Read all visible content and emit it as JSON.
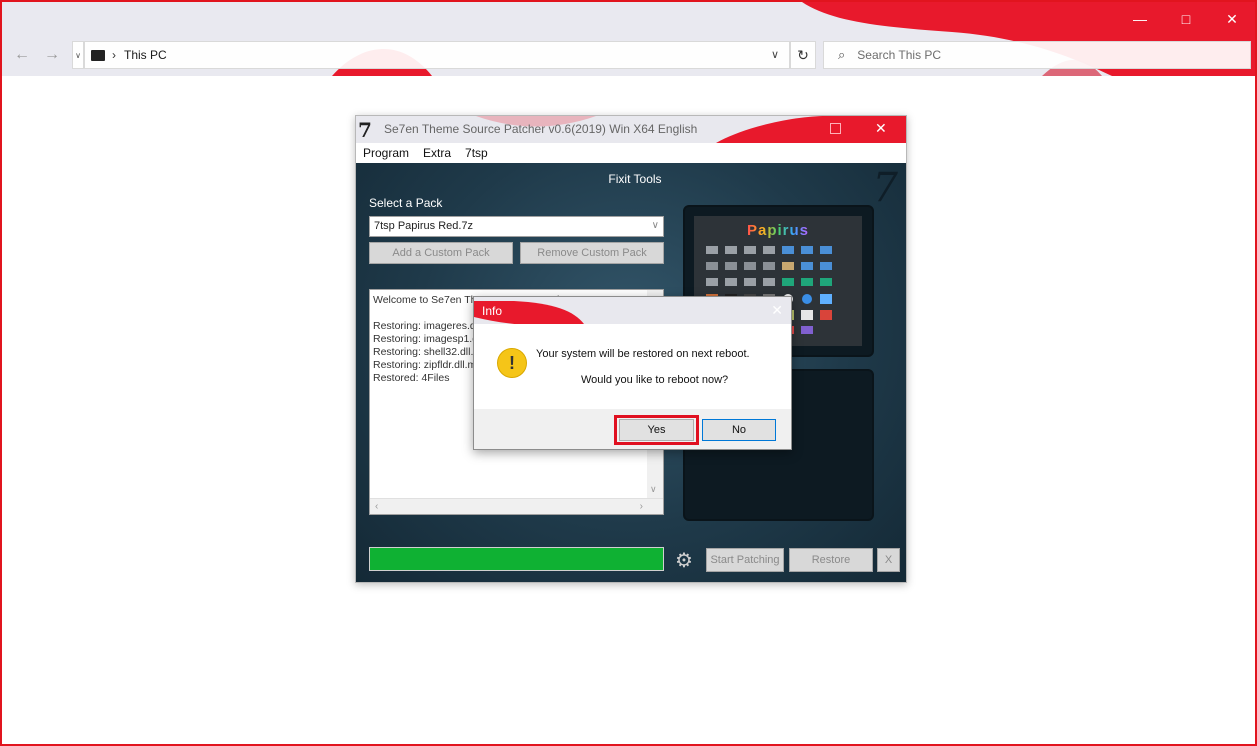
{
  "explorer": {
    "location": "This PC",
    "search_placeholder": "Search This PC",
    "nav": {
      "back": "←",
      "forward": "→",
      "dropdown": "∨",
      "chevron": "›",
      "refresh": "↻"
    },
    "controls": {
      "minimize": "—",
      "maximize": "□",
      "close": "✕"
    }
  },
  "app": {
    "logo": "7",
    "title": "Se7en Theme Source Patcher v0.6(2019) Win X64 English",
    "menu": [
      "Program",
      "Extra",
      "7tsp"
    ],
    "header": "Fixit Tools",
    "select_label": "Select a Pack",
    "selected_pack": "7tsp Papirus Red.7z",
    "add_button": "Add a Custom Pack",
    "remove_button": "Remove Custom Pack",
    "log_lines": [
      "Welcome to Se7en Theme Source Patcher",
      "",
      "Restoring: imageres.dll",
      "Restoring: imagesp1.dll",
      "Restoring: shell32.dll.mun",
      "Restoring: zipfldr.dll.mun",
      "Restored: 4Files"
    ],
    "preview_title": "Papirus",
    "start_button": "Start Patching",
    "restore_button": "Restore",
    "x_button": "X"
  },
  "dialog": {
    "title": "Info",
    "close": "✕",
    "icon_glyph": "!",
    "message_line1": "Your system will be restored on next reboot.",
    "message_line2": "Would you like to reboot now?",
    "yes": "Yes",
    "no": "No"
  },
  "colors": {
    "accent_red": "#e1141e",
    "progress_green": "#0fb133",
    "highlight_red": "#e01020"
  }
}
